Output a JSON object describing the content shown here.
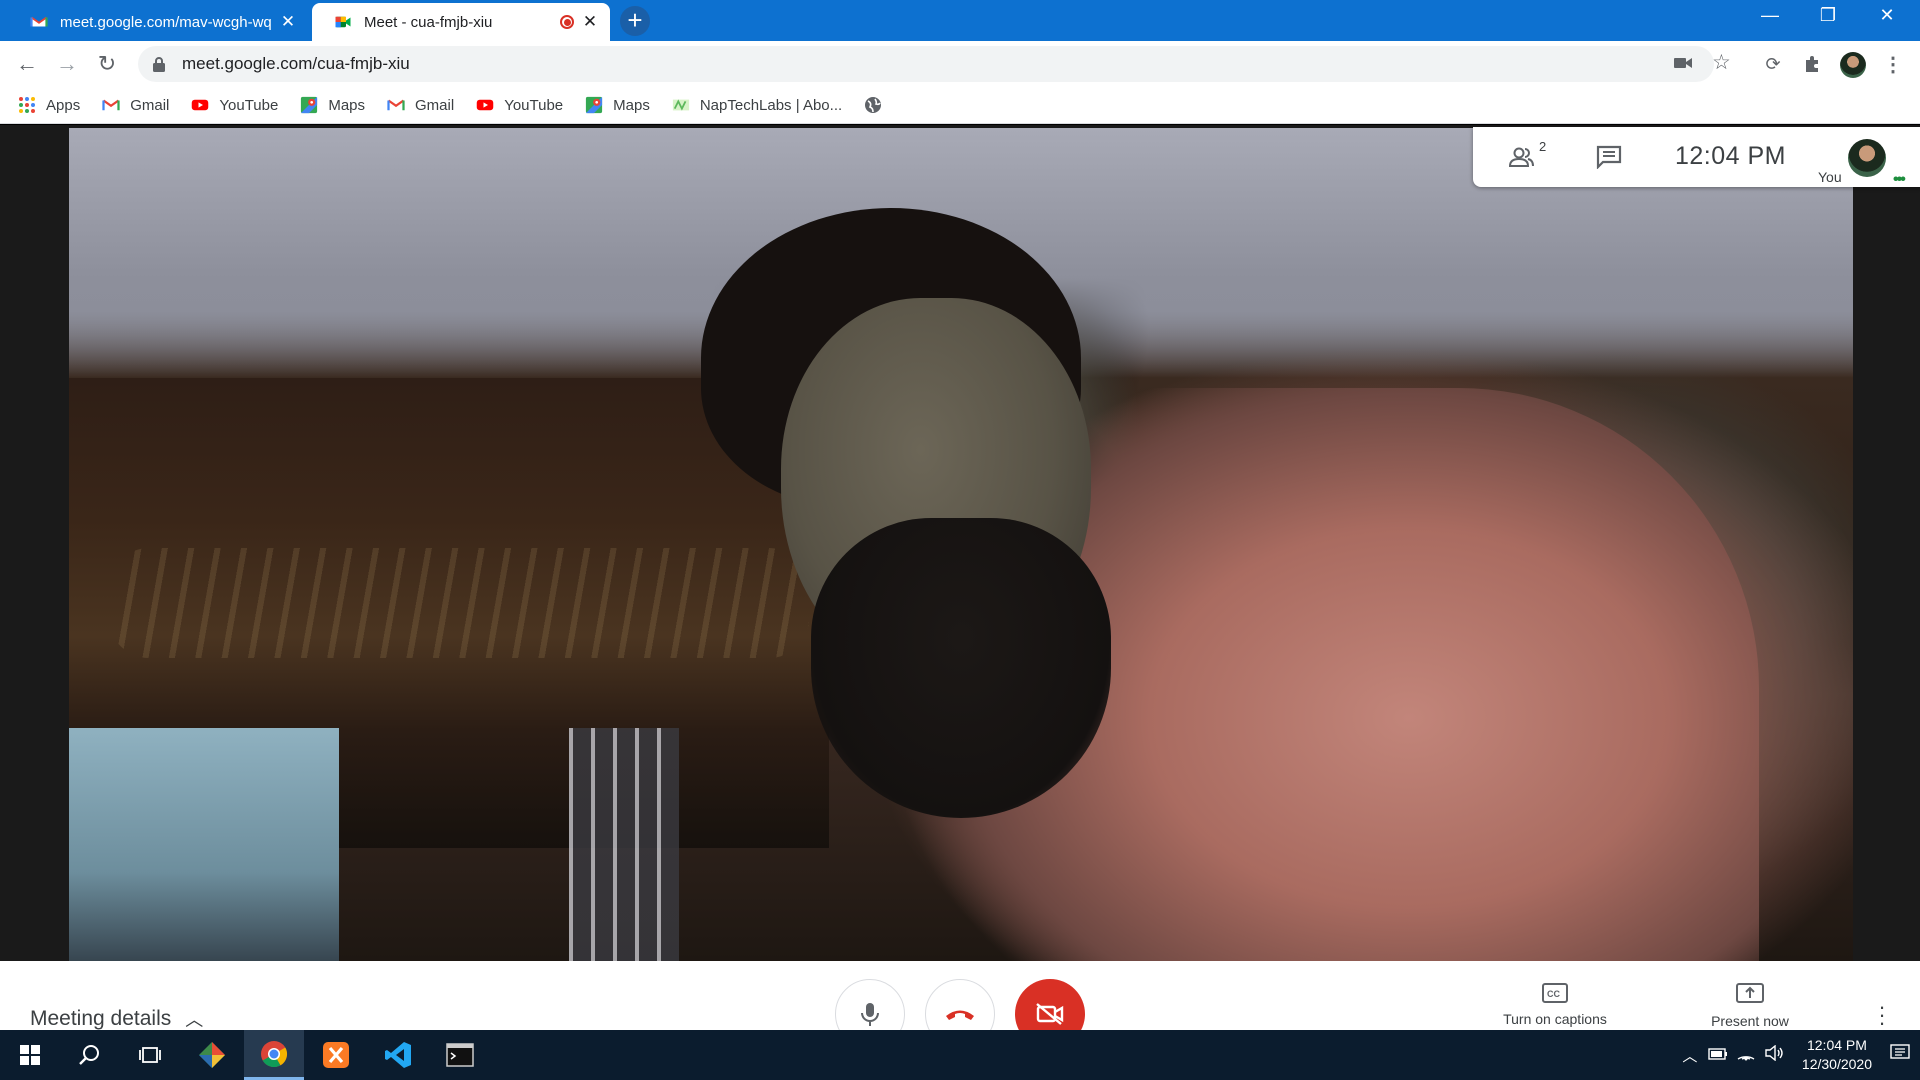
{
  "browser": {
    "tabs": [
      {
        "title": "meet.google.com/mav-wcgh-wq",
        "icon": "gmail-icon",
        "active": false
      },
      {
        "title": "Meet - cua-fmjb-xiu",
        "icon": "meet-icon",
        "active": true,
        "recording": true
      }
    ],
    "url": "meet.google.com/cua-fmjb-xiu",
    "bookmarks": [
      {
        "label": "Apps",
        "icon": "apps-grid-icon"
      },
      {
        "label": "Gmail",
        "icon": "gmail-icon"
      },
      {
        "label": "YouTube",
        "icon": "youtube-icon"
      },
      {
        "label": "Maps",
        "icon": "maps-icon"
      },
      {
        "label": "Gmail",
        "icon": "gmail-icon"
      },
      {
        "label": "YouTube",
        "icon": "youtube-icon"
      },
      {
        "label": "Maps",
        "icon": "maps-icon"
      },
      {
        "label": "NapTechLabs | Abo...",
        "icon": "naptechlabs-icon"
      }
    ]
  },
  "meet": {
    "participant_count": "2",
    "clock": "12:04  PM",
    "you_label": "You",
    "meeting_details_label": "Meeting details",
    "captions_label": "Turn on captions",
    "present_label": "Present now",
    "camera_off": true,
    "accent_red": "#d93025"
  },
  "taskbar": {
    "time": "12:04 PM",
    "date": "12/30/2020",
    "pinned": [
      "windows-start-icon",
      "search-icon",
      "task-view-icon",
      "sourcetree-icon",
      "chrome-icon",
      "xampp-icon",
      "vscode-icon",
      "terminal-icon"
    ]
  }
}
